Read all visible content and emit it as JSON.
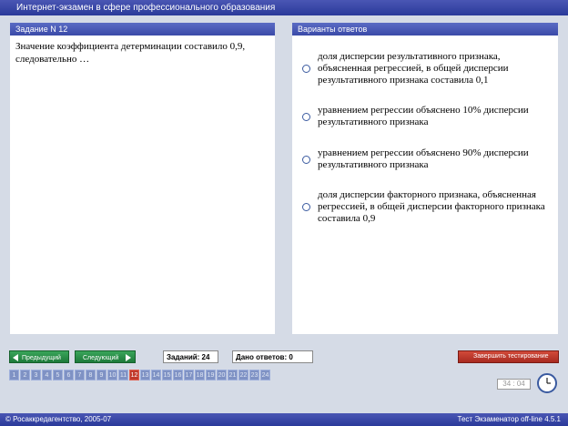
{
  "app": {
    "title": "Интернет-экзамен в сфере профессионального образования"
  },
  "question_panel": {
    "header": "Задание N 12",
    "text": "Значение коэффициента детерминации составило 0,9, следовательно …"
  },
  "answers_panel": {
    "header": "Варианты ответов",
    "options": [
      {
        "label": "доля дисперсии результативного признака, объясненная  регрессией, в общей дисперсии результативного признака составила 0,1"
      },
      {
        "label": "уравнением регрессии объяснено 10% дисперсии результативного признака"
      },
      {
        "label": "уравнением регрессии объяснено 90% дисперсии результативного признака"
      },
      {
        "label": "доля дисперсии факторного признака, объясненная  регрессией, в общей дисперсии факторного признака составила 0,9"
      }
    ]
  },
  "navigation": {
    "prev_label": "Предыдущий",
    "next_label": "Следующий",
    "tasks_label": "Заданий: 24",
    "answered_label": "Дано ответов: 0",
    "finish_label": "Завершить тестирование"
  },
  "pages": [
    "1",
    "2",
    "3",
    "4",
    "5",
    "6",
    "7",
    "8",
    "9",
    "10",
    "11",
    "12",
    "13",
    "14",
    "15",
    "16",
    "17",
    "18",
    "19",
    "20",
    "21",
    "22",
    "23",
    "24"
  ],
  "current_page": "12",
  "timer": "34 : 04",
  "footer": {
    "left": "© Росаккредагентство, 2005-07",
    "right": "Тест Экзаменатор off-line 4.5.1"
  }
}
